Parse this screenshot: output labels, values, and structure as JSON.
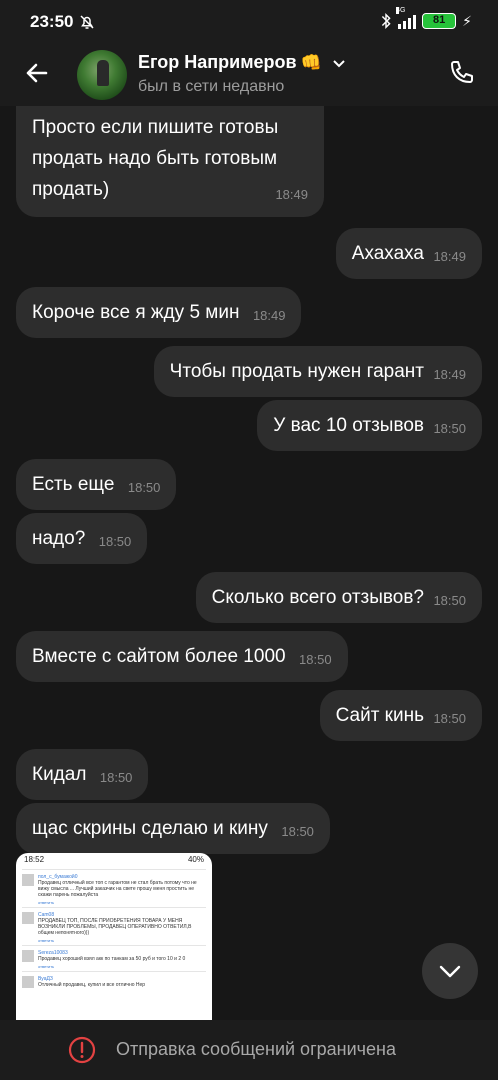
{
  "status_bar": {
    "time": "23:50",
    "network": "4G",
    "battery": "81"
  },
  "header": {
    "contact_name": "Егор Напримеров",
    "emoji": "👊",
    "status": "был в сети недавно"
  },
  "messages": [
    {
      "side": "in",
      "text": "Просто если пишите готовы продать надо быть готовым продать)",
      "time": "18:49"
    },
    {
      "side": "out",
      "text": "Ахахаха",
      "time": "18:49"
    },
    {
      "side": "in",
      "text": "Короче все я жду 5 мин",
      "time": "18:49"
    },
    {
      "side": "out",
      "text": "Чтобы продать нужен гарант",
      "time": "18:49"
    },
    {
      "side": "out",
      "text": "У вас 10 отзывов",
      "time": "18:50"
    },
    {
      "side": "in",
      "text": "Есть еще",
      "time": "18:50"
    },
    {
      "side": "in",
      "text": "надо?",
      "time": "18:50"
    },
    {
      "side": "out",
      "text": "Сколько всего отзывов?",
      "time": "18:50"
    },
    {
      "side": "in",
      "text": "Вместе с сайтом более 1000",
      "time": "18:50"
    },
    {
      "side": "out",
      "text": "Сайт кинь",
      "time": "18:50"
    },
    {
      "side": "in",
      "text": "Кидал",
      "time": "18:50"
    },
    {
      "side": "in",
      "text": "щас скрины сделаю и кину",
      "time": "18:50"
    }
  ],
  "attachment": {
    "time": "18:52",
    "battery": "40%",
    "reviews": [
      {
        "user": "пол_с_бумажой0",
        "text": "Продавец отличный все топ с гарантом не стал брать потому что не вижу смысла ... Лучший заказчик на свете прошу меня простить не скажи парень пожалуйста"
      },
      {
        "user": "Cam08",
        "text": "ПРОДАВЕЦ ТОП, ПОСЛЕ ПРИОБРЕТЕНИЯ ТОВАРА У МЕНЯ ВОЗНИКЛИ ПРОБЛЕМЫ, ПРОДАВЕЦ ОПЕРАТИВНО ОТВЕТИЛ,В общем непонятного)))"
      },
      {
        "user": "Sereza10083",
        "text": "Продавец хороший взял акк по танкам за 50 руб и того 10 и 2 0"
      },
      {
        "user": "ВуаДЗ",
        "text": "Отличный продавец, купил и все отлично Нер"
      }
    ],
    "reply_label": "ответить"
  },
  "footer": {
    "notice": "Отправка сообщений ограничена"
  },
  "colors": {
    "background": "#171717",
    "bubble": "#2d2d2d",
    "accent_warning": "#e34242"
  }
}
